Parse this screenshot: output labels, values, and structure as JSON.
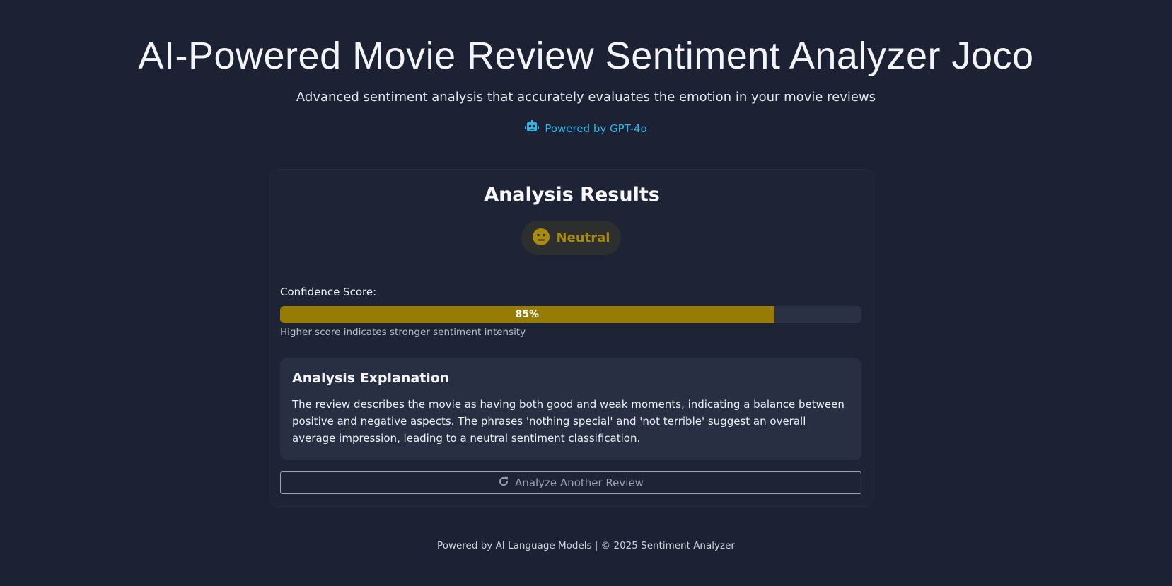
{
  "header": {
    "title": "AI-Powered Movie Review Sentiment Analyzer Joco",
    "subtitle": "Advanced sentiment analysis that accurately evaluates the emotion in your movie reviews",
    "powered_by": "Powered by GPT-4o",
    "powered_icon": "robot-icon"
  },
  "results": {
    "title": "Analysis Results",
    "sentiment_label": "Neutral",
    "sentiment_icon": "neutral-face-icon",
    "confidence_label": "Confidence Score:",
    "confidence_value": 0.85,
    "confidence_text": "85%",
    "confidence_note": "Higher score indicates stronger sentiment intensity",
    "explanation_title": "Analysis Explanation",
    "explanation_text": "The review describes the movie as having both good and weak moments, indicating a balance between positive and negative aspects. The phrases 'nothing special' and 'not terrible' suggest an overall average impression, leading to a neutral sentiment classification.",
    "reset_button_label": "Analyze Another Review",
    "reset_icon": "redo-icon"
  },
  "footer": {
    "text": "Powered by AI Language Models | © 2025 Sentiment Analyzer"
  },
  "colors": {
    "background": "#1c2233",
    "accent_blue": "#2fb7e6",
    "neutral_gold": "#967c04",
    "panel": "#292f42"
  }
}
